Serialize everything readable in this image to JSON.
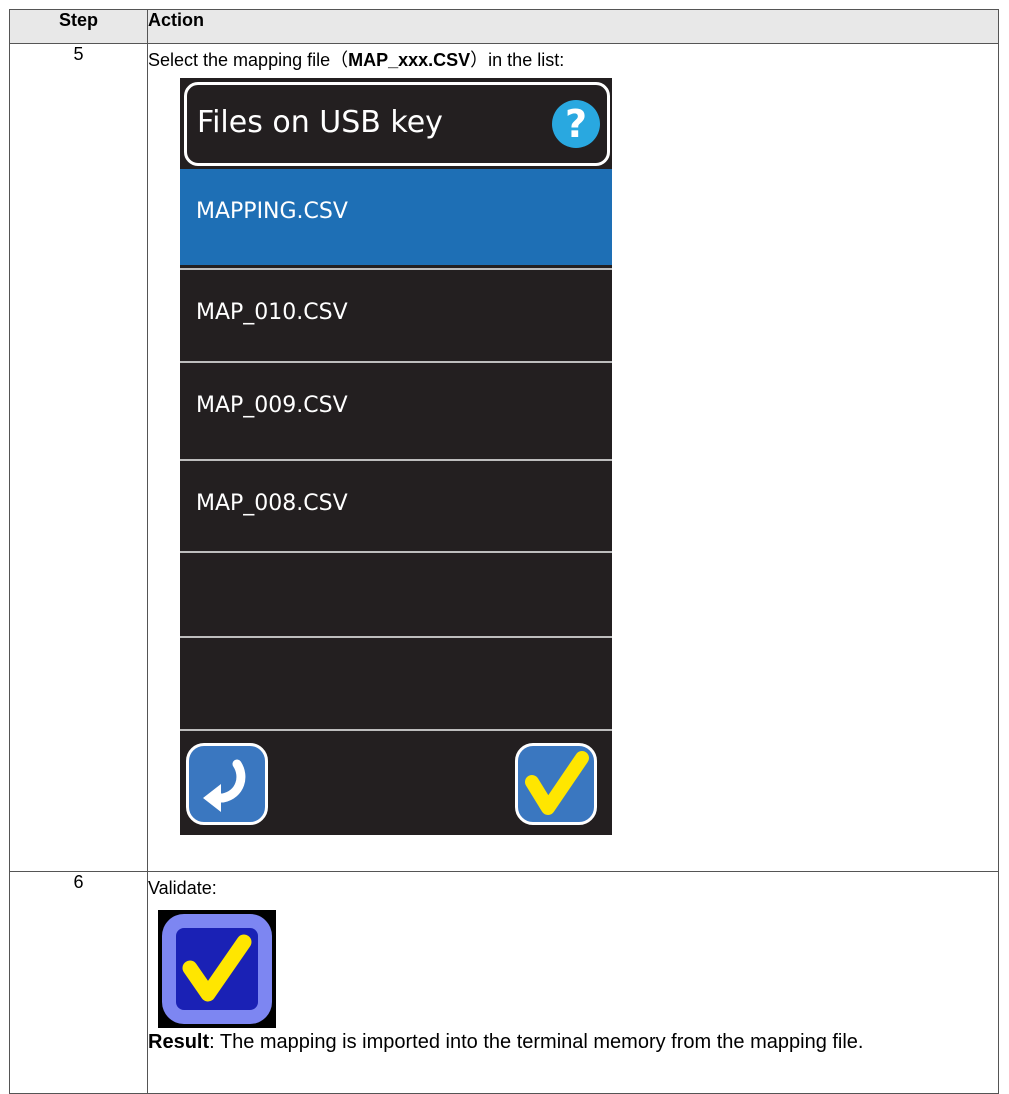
{
  "table": {
    "header_step": "Step",
    "header_action": "Action"
  },
  "row5": {
    "step": "5",
    "text_before": "Select the mapping file（",
    "text_bold": "MAP_xxx.CSV",
    "text_after": "）in the list:",
    "screen": {
      "title": "Files on USB key",
      "help_icon": "question-mark-icon",
      "files": [
        "MAPPING.CSV",
        "MAP_010.CSV",
        "MAP_009.CSV",
        "MAP_008.CSV",
        "",
        ""
      ],
      "selected_index": 0,
      "back_icon": "return-arrow-icon",
      "confirm_icon": "checkmark-icon"
    }
  },
  "row6": {
    "step": "6",
    "text": "Validate:",
    "validate_icon": "checkmark-icon",
    "result_label": "Result",
    "result_text": ": The mapping is imported into the terminal memory from the mapping file."
  },
  "colors": {
    "screen_bg": "#231f20",
    "selected_bg": "#1e6fb5",
    "help_blue": "#29a8e0",
    "check_yellow": "#ffe600",
    "validate_outer": "#7d86f2",
    "validate_inner": "#1a21b5"
  }
}
